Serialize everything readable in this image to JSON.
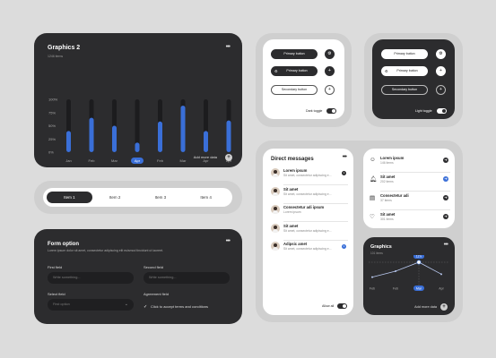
{
  "bar_card": {
    "title": "Graphics  2",
    "subtitle": "1246 items",
    "footer": "Add more data",
    "plus_icon": "+",
    "more_icon": "•••"
  },
  "chart_data": [
    {
      "type": "bar",
      "title": "Graphics  2",
      "categories": [
        "Jan",
        "Feb",
        "Mar",
        "Apr",
        "Feb",
        "Mar",
        "Apr",
        "Apr"
      ],
      "highlight_category_index": 3,
      "values": [
        40,
        65,
        50,
        18,
        58,
        88,
        40,
        60
      ],
      "ylim": [
        0,
        100
      ],
      "yticks": [
        "100%",
        "75%",
        "50%",
        "25%",
        "0%"
      ],
      "bar_color": "#3a6fd8",
      "track_color": "#1c1c1e"
    },
    {
      "type": "line",
      "title": "Graphics",
      "categories": [
        "Feb",
        "Feb",
        "Mar",
        "Apr"
      ],
      "highlight_category_index": 2,
      "values": [
        2,
        6,
        12,
        4
      ],
      "highlight_label": "12 k",
      "line_color": "#b9c9f0"
    }
  ],
  "tabs": [
    "Item 1",
    "Item 2",
    "Item 3",
    "Item 4"
  ],
  "form": {
    "title": "Form option",
    "description": "Lorem ipsum dolor sit amet, consectetur adipiscing elit euismod tincidunt ut laoreet.",
    "first_label": "First field",
    "first_placeholder": "Write something...",
    "second_label": "Second field",
    "second_placeholder": "Write something...",
    "select_label": "Select field",
    "select_value": "First option",
    "agreement_label": "Agreement field",
    "agreement_text": "Click to accept terms and conditions"
  },
  "buttons_light": {
    "primary": "Primary button",
    "primary_icon": "Primary button",
    "secondary": "Secondary button",
    "toggle_label": "Dark toggle"
  },
  "buttons_dark": {
    "primary": "Primary button",
    "primary_icon": "Primary button",
    "secondary": "Secondary button",
    "toggle_label": "Light toggle"
  },
  "messages": {
    "title": "Direct messages",
    "allow_label": "Allow all",
    "rows": [
      {
        "name": "Lorem ipsum",
        "text": "Sit amet, consectetur adipiscing e...",
        "badge": "1",
        "badge_color": "#2c2c2e"
      },
      {
        "name": "Sit amet",
        "text": "Sit amet, consectetur adipiscing e...",
        "badge": "",
        "badge_color": ""
      },
      {
        "name": "Consectetur adi ipsum",
        "text": "Lorem ipsum",
        "badge": "",
        "badge_color": ""
      },
      {
        "name": "Sit amet",
        "text": "Sit amet, consectetur adipiscing e...",
        "badge": "",
        "badge_color": ""
      },
      {
        "name": "Adipsic amet",
        "text": "Sit amet, consectetur adipiscing e...",
        "badge": "1",
        "badge_color": "#3a6fd8"
      }
    ]
  },
  "item_list": [
    {
      "name": "Lorem ipsum",
      "count": "146 items",
      "icon": "☺"
    },
    {
      "name": "Sit amet",
      "count": "202 items",
      "icon": "♫"
    },
    {
      "name": "Consectetur adi",
      "count": "37 items",
      "icon": "▤"
    },
    {
      "name": "Sit amet",
      "count": "301 items",
      "icon": "♡"
    }
  ],
  "line_card": {
    "title": "Graphics",
    "subtitle": "101 items",
    "footer": "Add more data"
  }
}
